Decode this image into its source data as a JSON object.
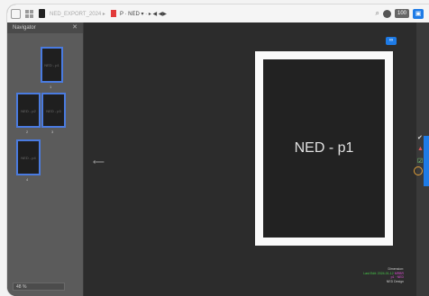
{
  "toolbar": {
    "breadcrumb": "NED_EXPORT_2024 ▸",
    "page_selector": "P · NED ▾ · ▸ ◀ ◀▶",
    "zoom": "100",
    "panel_toggle": "▣"
  },
  "navigator": {
    "title": "Navigator",
    "close": "✕",
    "thumbnails": [
      {
        "label": "NED - p1",
        "number": "1"
      },
      {
        "label": "NED - p2",
        "number": "2"
      },
      {
        "label": "NED - p3",
        "number": "3"
      },
      {
        "label": "NED - p4",
        "number": "4"
      }
    ],
    "zoom_value": "48 %"
  },
  "canvas": {
    "page_label": "NED - p1",
    "link_badge": "∞",
    "notes": {
      "line1": "Dimension:",
      "line2_prefix": "Last Edit: 2024-01-12",
      "line2_suffix": "MRBR",
      "line3": "p1 · NED",
      "line4": "NED Design"
    }
  },
  "colors": {
    "accent": "#1e7be6",
    "selection": "#4a7be0",
    "canvas": "#2c2c2c"
  }
}
